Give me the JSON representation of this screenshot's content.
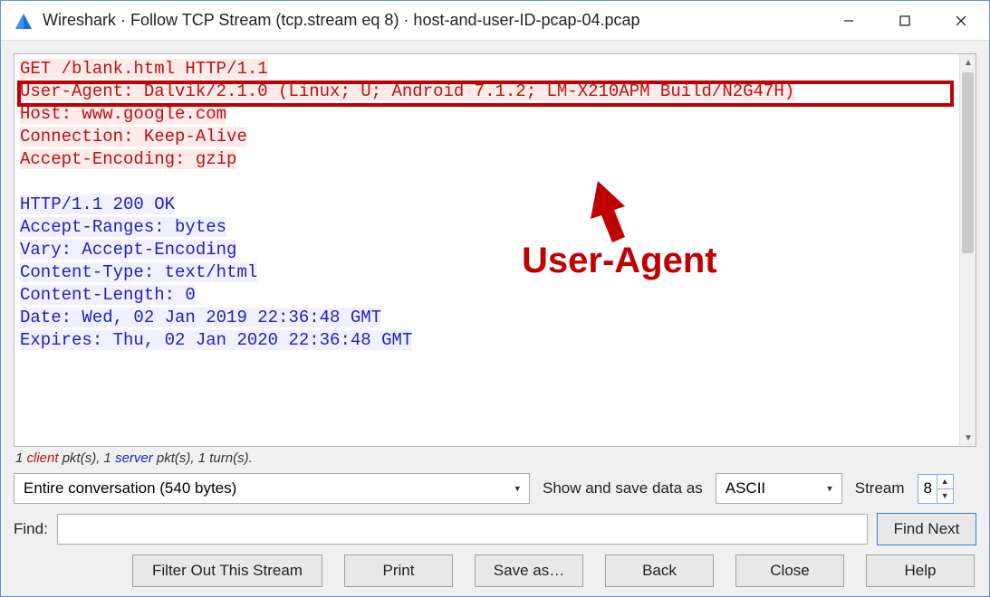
{
  "titlebar": {
    "title": "Wireshark · Follow TCP Stream (tcp.stream eq 8) · host-and-user-ID-pcap-04.pcap"
  },
  "stream": {
    "request_lines": [
      "GET /blank.html HTTP/1.1",
      "User-Agent: Dalvik/2.1.0 (Linux; U; Android 7.1.2; LM-X210APM Build/N2G47H)",
      "Host: www.google.com",
      "Connection: Keep-Alive",
      "Accept-Encoding: gzip"
    ],
    "response_lines": [
      "HTTP/1.1 200 OK",
      "Accept-Ranges: bytes",
      "Vary: Accept-Encoding",
      "Content-Type: text/html",
      "Content-Length: 0",
      "Date: Wed, 02 Jan 2019 22:36:48 GMT",
      "Expires: Thu, 02 Jan 2020 22:36:48 GMT"
    ]
  },
  "annotation": {
    "label": "User-Agent"
  },
  "info_line": {
    "prefix": "1 ",
    "client_word": "client",
    "mid1": " pkt(s), 1 ",
    "server_word": "server",
    "suffix": " pkt(s), 1 turn(s)."
  },
  "controls": {
    "conversation_select": "Entire conversation (540 bytes)",
    "show_save_label": "Show and save data as",
    "format_select": "ASCII",
    "stream_label": "Stream",
    "stream_value": "8",
    "find_label": "Find:",
    "find_value": "",
    "find_next_btn": "Find Next"
  },
  "buttons": {
    "filter_out": "Filter Out This Stream",
    "print": "Print",
    "save_as": "Save as…",
    "back": "Back",
    "close": "Close",
    "help": "Help"
  }
}
